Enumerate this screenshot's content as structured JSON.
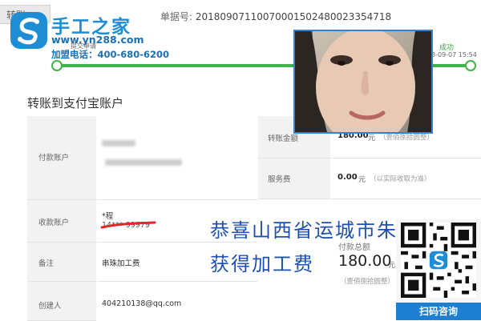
{
  "top_tab": {
    "label": "转账"
  },
  "receipt": {
    "label": "单据号:",
    "number": "20180907110070001502480023354718"
  },
  "brand": {
    "name": "手工之家",
    "url": "www.yn288.com",
    "phone": "加盟电话：400-680-6200"
  },
  "progress": {
    "steps": [
      {
        "label": "提交申请"
      },
      {
        "label": "成功",
        "time": "8-09-07 15:54"
      }
    ],
    "color": "#3fb549"
  },
  "section_title": "转账到支付宝账户",
  "payer": {
    "label": "付款账户"
  },
  "amount": {
    "label": "转账金额",
    "value": "180.00",
    "unit": "元",
    "note": "（壹佰捌拾圆整）"
  },
  "service_fee": {
    "label": "服务费",
    "value": "0.00",
    "unit": "元",
    "note": "（以实际收取为准）"
  },
  "payee": {
    "label": "收款账户",
    "name": "*程",
    "number": "14***-99979"
  },
  "remark": {
    "label": "备注",
    "value": "串珠加工费"
  },
  "creator": {
    "label": "创建人",
    "value": "404210138@qq.com"
  },
  "total": {
    "label": "付款总额",
    "value": "180.00",
    "unit": "元",
    "note": "（壹佰捌拾圆整）"
  },
  "promo": {
    "line1": "恭喜山西省运城市朱女士",
    "line2": "获得加工费"
  },
  "qr": {
    "label": "扫码咨询"
  },
  "colors": {
    "brand_blue": "#1d8ed6",
    "promo_blue": "#1f4fb3",
    "qr_label_bg": "#1d7fd2",
    "photo_border": "#3a80d1"
  }
}
